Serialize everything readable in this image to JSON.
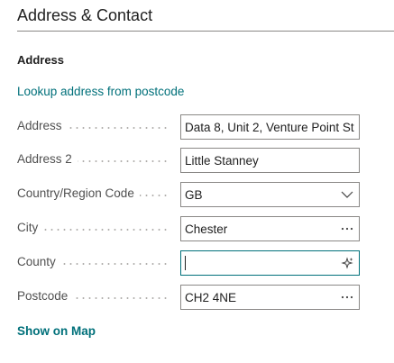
{
  "section": {
    "title": "Address & Contact"
  },
  "group": {
    "title": "Address"
  },
  "lookup_link": "Lookup address from postcode",
  "fields": {
    "address": {
      "label": "Address",
      "value": "Data 8, Unit 2, Venture Point St"
    },
    "address2": {
      "label": "Address 2",
      "value": "Little Stanney"
    },
    "country": {
      "label": "Country/Region Code",
      "value": "GB"
    },
    "city": {
      "label": "City",
      "value": "Chester"
    },
    "county": {
      "label": "County",
      "value": ""
    },
    "postcode": {
      "label": "Postcode",
      "value": "CH2 4NE"
    }
  },
  "show_on_map": "Show on Map",
  "icons": {
    "dropdown": "chevron-down-icon",
    "lookup": "ellipsis-icon",
    "ai_assist": "sparkle-icon"
  },
  "colors": {
    "accent": "#00707a",
    "border": "#8a8886"
  }
}
